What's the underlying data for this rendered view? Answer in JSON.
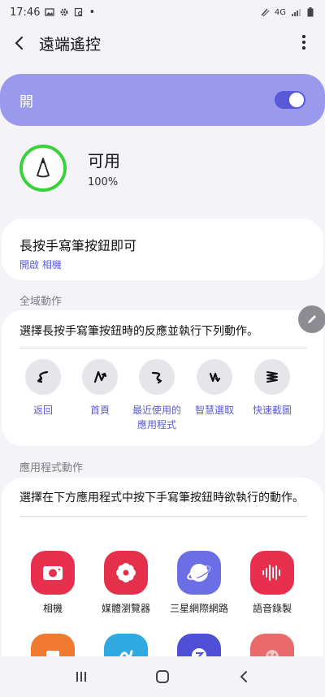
{
  "status_bar": {
    "time": "17:46",
    "dot": "•",
    "network": "4G"
  },
  "header": {
    "title": "遠端遙控"
  },
  "master": {
    "label": "開",
    "on": true
  },
  "pen": {
    "status": "可用",
    "battery": "100%"
  },
  "hold": {
    "title": "長按手寫筆按鈕即可",
    "subtitle": "開啟 相機"
  },
  "global_actions": {
    "section_label": "全域動作",
    "description": "選擇長按手寫筆按鈕時的反應並執行下列動作。",
    "items": [
      {
        "label": "返回",
        "icon": "gesture-back-icon"
      },
      {
        "label": "首頁",
        "icon": "gesture-home-icon"
      },
      {
        "label": "最近使用的\n應用程式",
        "icon": "gesture-recent-icon"
      },
      {
        "label": "智慧選取",
        "icon": "gesture-smart-select-icon"
      },
      {
        "label": "快速截圖",
        "icon": "gesture-screenshot-icon"
      }
    ]
  },
  "app_actions": {
    "section_label": "應用程式動作",
    "description": "選擇在下方應用程式中按下手寫筆按鈕時欲執行的動作。",
    "apps": [
      {
        "label": "相機",
        "color": "#e8304e",
        "icon": "camera-icon"
      },
      {
        "label": "媒體瀏覽器",
        "color": "#e5304c",
        "icon": "gallery-flower-icon"
      },
      {
        "label": "三星網際網路",
        "color": "#6c6ee6",
        "icon": "internet-planet-icon"
      },
      {
        "label": "語音錄製",
        "color": "#e8304e",
        "icon": "voice-recorder-icon"
      },
      {
        "label": "",
        "color": "#f07a2f",
        "icon": "app-orange-icon"
      },
      {
        "label": "",
        "color": "#2fa9e0",
        "icon": "app-blue-icon"
      },
      {
        "label": "",
        "color": "#4f4fd6",
        "icon": "app-indigo-icon"
      },
      {
        "label": "",
        "color": "#e86a6a",
        "icon": "app-red-icon"
      }
    ]
  },
  "colors": {
    "accent": "#5b5bd6",
    "switch_bg": "#9a99ee",
    "battery_ring": "#3bd13b"
  }
}
